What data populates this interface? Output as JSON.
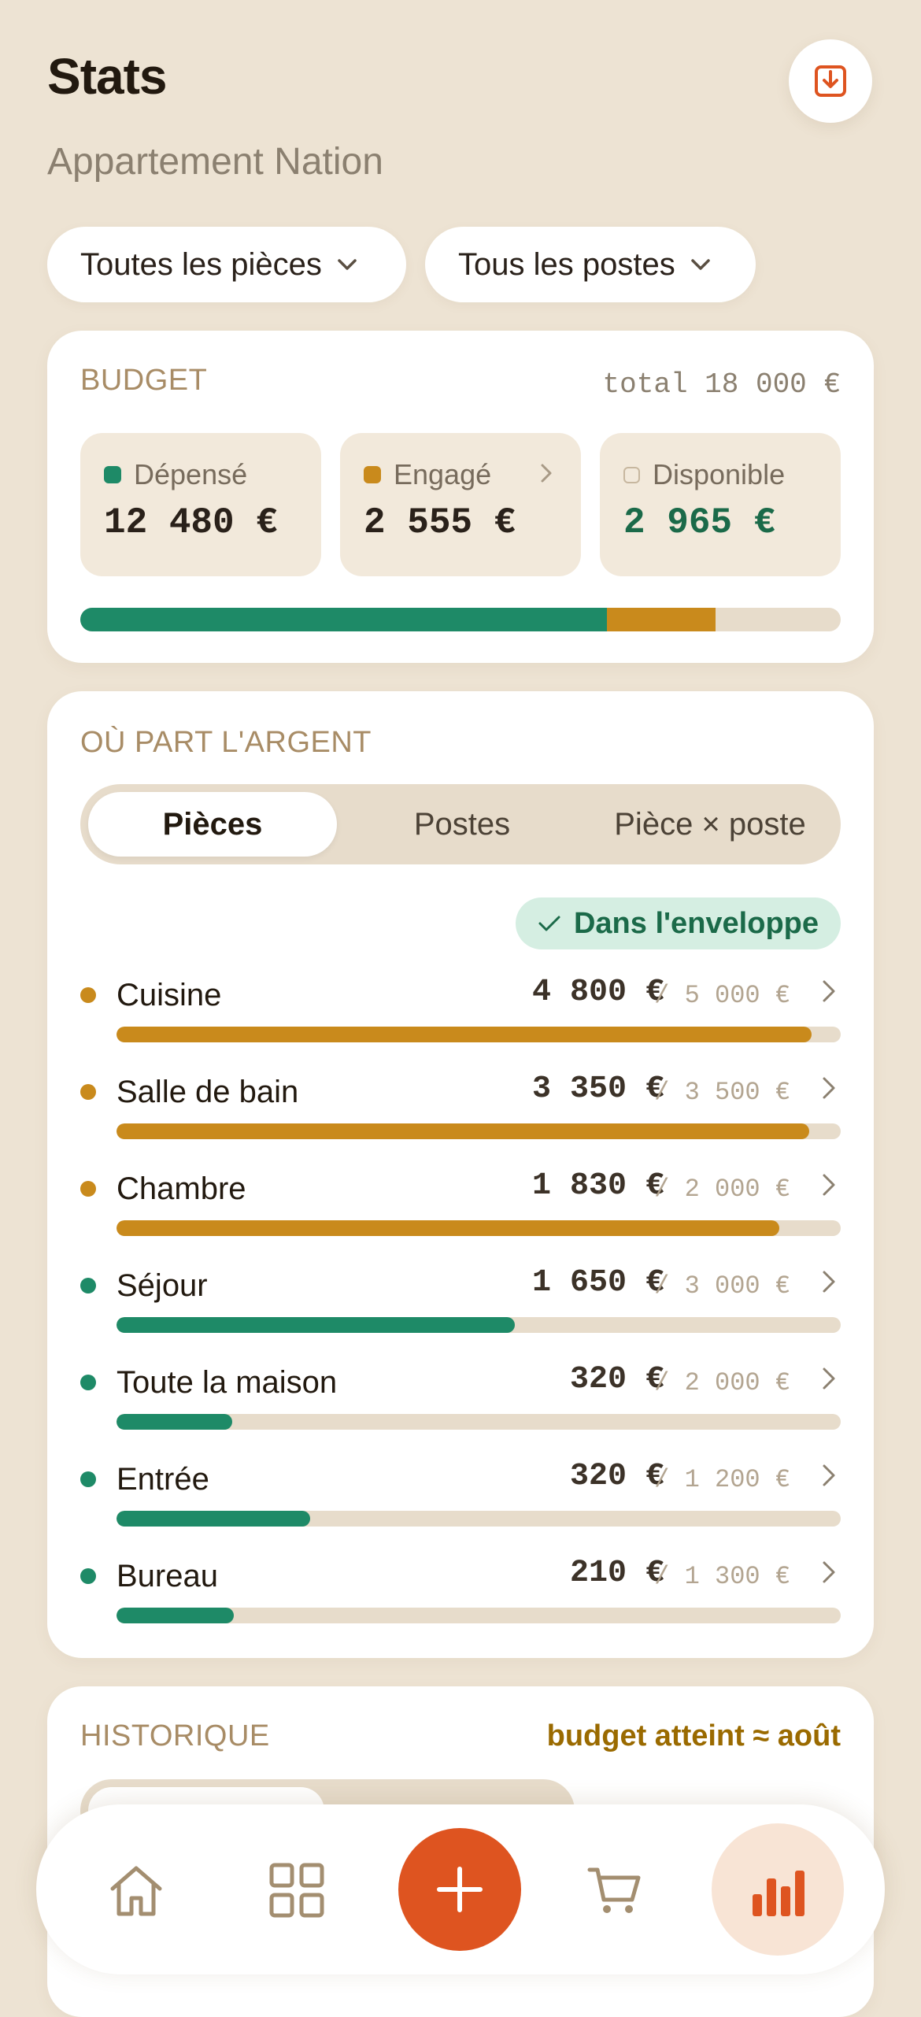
{
  "header": {
    "title": "Stats",
    "subtitle": "Appartement Nation"
  },
  "filters": {
    "rooms": "Toutes les pièces",
    "items": "Tous les postes"
  },
  "budget": {
    "label": "BUDGET",
    "total": "total 18 000 €",
    "spent_label": "Dépensé",
    "spent_value": "12 480 €",
    "committed_label": "Engagé",
    "committed_value": "2 555 €",
    "available_label": "Disponible",
    "available_value": "2 965 €",
    "spent_fraction": 0.693,
    "committed_fraction": 0.142
  },
  "breakdown": {
    "label": "OÙ PART L'ARGENT",
    "tabs": [
      "Pièces",
      "Postes",
      "Pièce × poste"
    ],
    "active_tab": 0,
    "badge": "Dans l'enveloppe",
    "rows": [
      {
        "name": "Cuisine",
        "amount": "4 800 €",
        "budget": "/ 5 000 €",
        "fraction": 0.96,
        "color": "#c98a1c"
      },
      {
        "name": "Salle de bain",
        "amount": "3 350 €",
        "budget": "/ 3 500 €",
        "fraction": 0.957,
        "color": "#c98a1c"
      },
      {
        "name": "Chambre",
        "amount": "1 830 €",
        "budget": "/ 2 000 €",
        "fraction": 0.915,
        "color": "#c98a1c"
      },
      {
        "name": "Séjour",
        "amount": "1 650 €",
        "budget": "/ 3 000 €",
        "fraction": 0.55,
        "color": "#1e8a67"
      },
      {
        "name": "Toute la maison",
        "amount": "320 €",
        "budget": "/ 2 000 €",
        "fraction": 0.16,
        "color": "#1e8a67"
      },
      {
        "name": "Entrée",
        "amount": "320 €",
        "budget": "/ 1 200 €",
        "fraction": 0.267,
        "color": "#1e8a67"
      },
      {
        "name": "Bureau",
        "amount": "210 €",
        "budget": "/ 1 300 €",
        "fraction": 0.162,
        "color": "#1e8a67"
      }
    ]
  },
  "history": {
    "label": "HISTORIQUE",
    "note": "budget atteint ≈ août"
  },
  "colors": {
    "green": "#1e8a67",
    "amber": "#c98a1c",
    "accent": "#de5420"
  },
  "nav": {
    "items": [
      "home-icon",
      "grid-icon",
      "add-icon",
      "cart-icon",
      "stats-icon"
    ],
    "active": "stats-icon"
  }
}
